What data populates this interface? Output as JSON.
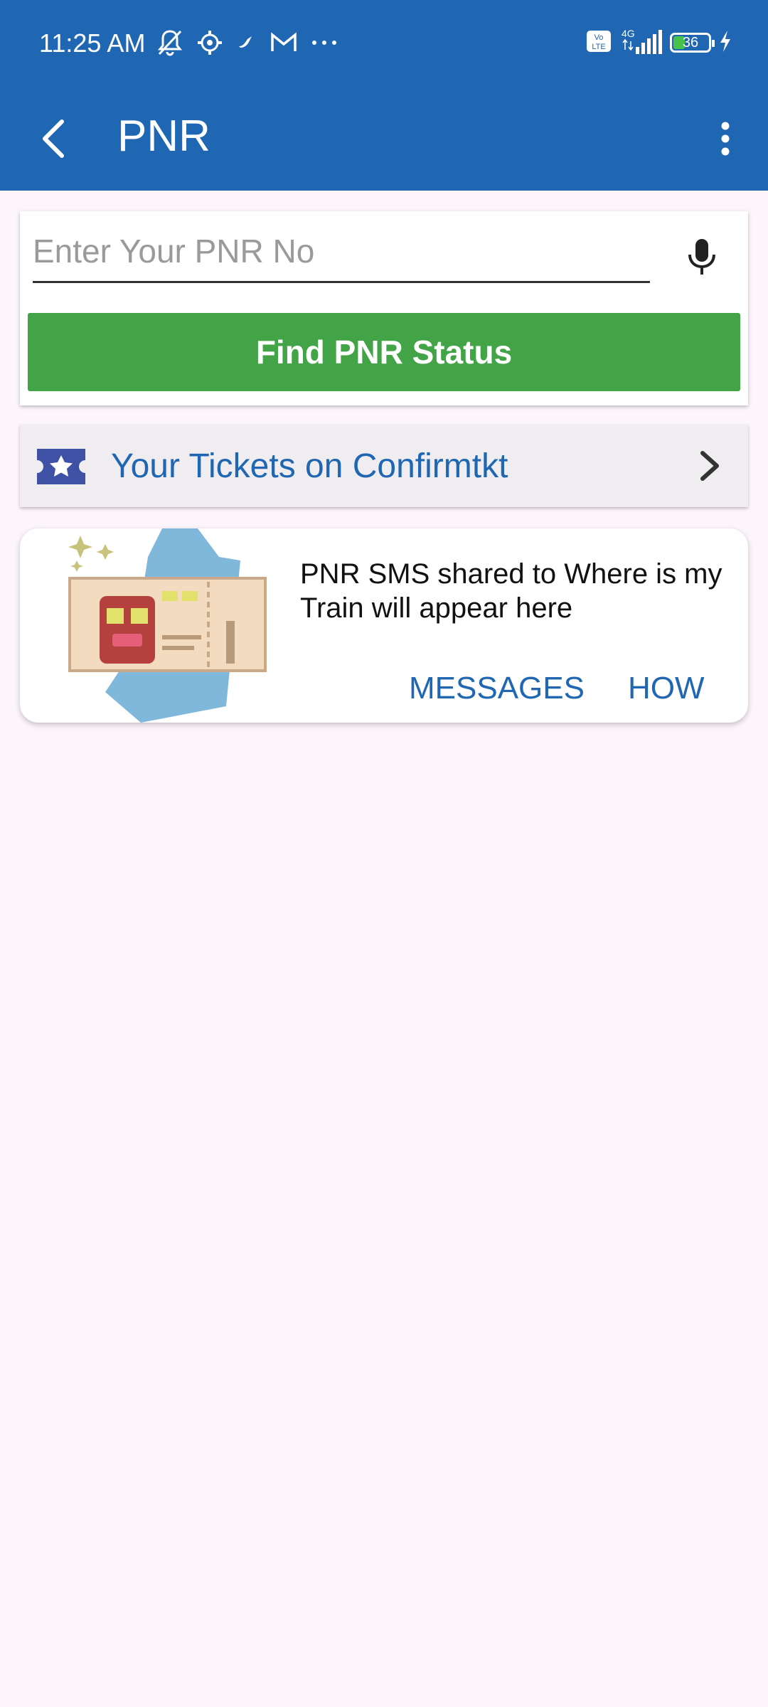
{
  "status_bar": {
    "time": "11:25 AM",
    "network": "4G",
    "volte": "Vo LTE",
    "battery_level": "36",
    "icons": [
      "muted-bell-icon",
      "settings-icon",
      "wind-icon",
      "gmail-icon",
      "more-dots-icon",
      "volte-icon",
      "signal-icon",
      "battery-icon",
      "charging-icon"
    ]
  },
  "app_bar": {
    "title": "PNR",
    "back_icon": "back-arrow-icon",
    "menu_icon": "more-vert-icon"
  },
  "search": {
    "placeholder": "Enter Your PNR No",
    "value": "",
    "button_label": "Find PNR Status"
  },
  "tickets": {
    "label": "Your Tickets on Confirmtkt"
  },
  "sms_card": {
    "text": "PNR SMS shared to Where is my Train will appear here",
    "messages_label": "MESSAGES",
    "how_label": "HOW"
  },
  "colors": {
    "primary": "#1f66b3",
    "button_green": "#43a347",
    "background": "#fcf5fc",
    "ticket_icon": "#3f51a5"
  }
}
